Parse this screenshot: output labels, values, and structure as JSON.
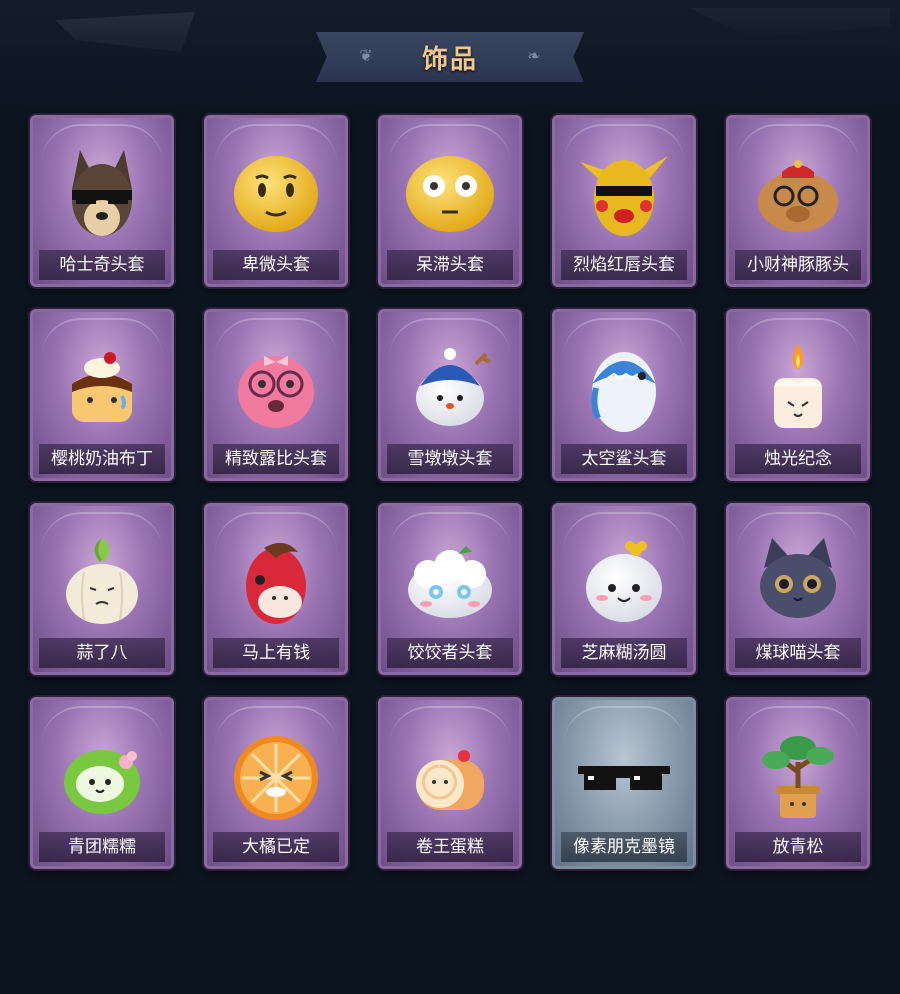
{
  "header": {
    "title": "饰品"
  },
  "items": [
    {
      "name": "哈士奇头套",
      "icon": "husky-mask-icon",
      "rarity": "purple"
    },
    {
      "name": "卑微头套",
      "icon": "humble-face-icon",
      "rarity": "purple"
    },
    {
      "name": "呆滞头套",
      "icon": "dazed-face-icon",
      "rarity": "purple"
    },
    {
      "name": "烈焰红唇头套",
      "icon": "red-lips-mask-icon",
      "rarity": "purple"
    },
    {
      "name": "小财神豚豚头",
      "icon": "capybara-god-icon",
      "rarity": "purple"
    },
    {
      "name": "樱桃奶油布丁",
      "icon": "cherry-pudding-icon",
      "rarity": "purple"
    },
    {
      "name": "精致露比头套",
      "icon": "ruby-beaver-icon",
      "rarity": "purple"
    },
    {
      "name": "雪墩墩头套",
      "icon": "snow-dundun-icon",
      "rarity": "purple"
    },
    {
      "name": "太空鲨头套",
      "icon": "space-shark-icon",
      "rarity": "purple"
    },
    {
      "name": "烛光纪念",
      "icon": "candle-icon",
      "rarity": "purple"
    },
    {
      "name": "蒜了八",
      "icon": "garlic-icon",
      "rarity": "purple"
    },
    {
      "name": "马上有钱",
      "icon": "horse-icon",
      "rarity": "purple"
    },
    {
      "name": "饺饺者头套",
      "icon": "dumpling-icon",
      "rarity": "purple"
    },
    {
      "name": "芝麻糊汤圆",
      "icon": "tangyuan-icon",
      "rarity": "purple"
    },
    {
      "name": "煤球喵头套",
      "icon": "black-cat-icon",
      "rarity": "purple"
    },
    {
      "name": "青团糯糯",
      "icon": "green-rice-ball-icon",
      "rarity": "purple"
    },
    {
      "name": "大橘已定",
      "icon": "orange-slice-icon",
      "rarity": "purple"
    },
    {
      "name": "卷王蛋糕",
      "icon": "roll-cake-icon",
      "rarity": "purple"
    },
    {
      "name": "像素朋克墨镜",
      "icon": "pixel-sunglasses-icon",
      "rarity": "gray"
    },
    {
      "name": "放青松",
      "icon": "bonsai-pine-icon",
      "rarity": "purple"
    }
  ]
}
